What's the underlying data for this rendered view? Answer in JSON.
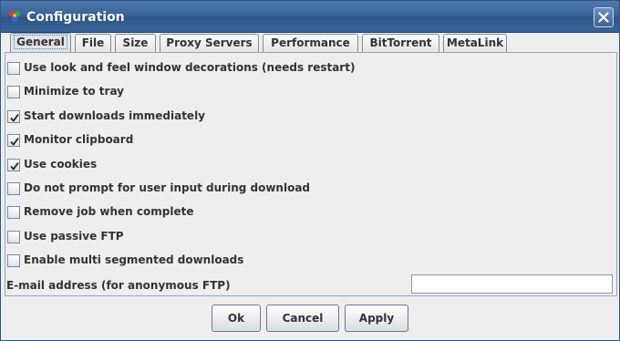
{
  "window": {
    "title": "Configuration",
    "app_icon": "colorful-gear-icon",
    "close_icon": "close-icon"
  },
  "tabs": [
    {
      "label": "General",
      "active": true
    },
    {
      "label": "File",
      "active": false
    },
    {
      "label": "Size",
      "active": false
    },
    {
      "label": "Proxy Servers",
      "active": false
    },
    {
      "label": "Performance",
      "active": false
    },
    {
      "label": "BitTorrent",
      "active": false
    },
    {
      "label": "MetaLink",
      "active": false
    }
  ],
  "options": [
    {
      "label": "Use look and feel window decorations (needs restart)",
      "checked": false
    },
    {
      "label": "Minimize to tray",
      "checked": false
    },
    {
      "label": "Start downloads immediately",
      "checked": true
    },
    {
      "label": "Monitor clipboard",
      "checked": true
    },
    {
      "label": "Use cookies",
      "checked": true
    },
    {
      "label": "Do not prompt for user input during download",
      "checked": false
    },
    {
      "label": "Remove job when complete",
      "checked": false
    },
    {
      "label": "Use passive FTP",
      "checked": false
    },
    {
      "label": "Enable multi segmented downloads",
      "checked": false
    }
  ],
  "email": {
    "label": "E-mail address (for anonymous FTP)",
    "value": ""
  },
  "buttons": {
    "ok": "Ok",
    "cancel": "Cancel",
    "apply": "Apply"
  },
  "colors": {
    "titlebar": "#3b6498",
    "background": "#eeeeee"
  }
}
